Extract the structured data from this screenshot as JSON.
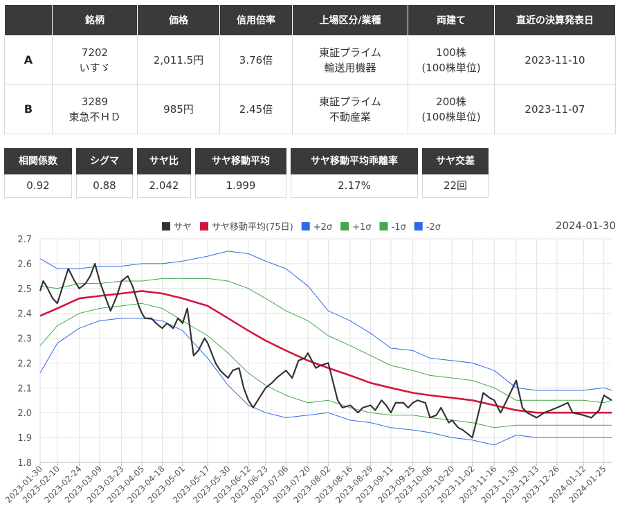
{
  "table": {
    "headers": [
      "",
      "銘柄",
      "価格",
      "信用倍率",
      "上場区分/業種",
      "両建て",
      "直近の決算発表日"
    ],
    "rows": [
      {
        "code": "A",
        "ticker": "7202",
        "name": "いすゞ",
        "price": "2,011.5円",
        "margin": "3.76倍",
        "market": "東証プライム",
        "industry": "輸送用機器",
        "hedge": "100株",
        "unit": "(100株単位)",
        "earnings": "2023-11-10"
      },
      {
        "code": "B",
        "ticker": "3289",
        "name": "東急不ＨＤ",
        "price": "985円",
        "margin": "2.45倍",
        "market": "東証プライム",
        "industry": "不動産業",
        "hedge": "200株",
        "unit": "(100株単位)",
        "earnings": "2023-11-07"
      }
    ]
  },
  "stats": [
    {
      "label": "相関係数",
      "value": "0.92"
    },
    {
      "label": "シグマ",
      "value": "0.88"
    },
    {
      "label": "サヤ比",
      "value": "2.042"
    },
    {
      "label": "サヤ移動平均",
      "value": "1.999"
    },
    {
      "label": "サヤ移動平均乖離率",
      "value": "2.17%"
    },
    {
      "label": "サヤ交差",
      "value": "22回"
    }
  ],
  "chart_data": {
    "type": "line",
    "date_label": "2024-01-30",
    "ylim": [
      1.8,
      2.7
    ],
    "y_ticks": [
      1.8,
      1.9,
      2.0,
      2.1,
      2.2,
      2.3,
      2.4,
      2.5,
      2.6,
      2.7
    ],
    "x_range": [
      "2023-01-30",
      "2024-01-30"
    ],
    "x_ticks": [
      "2023-01-30",
      "2023-02-10",
      "2023-02-24",
      "2023-03-09",
      "2023-03-23",
      "2023-04-05",
      "2023-04-18",
      "2023-05-01",
      "2023-05-17",
      "2023-05-30",
      "2023-06-12",
      "2023-06-23",
      "2023-07-06",
      "2023-07-20",
      "2023-08-02",
      "2023-08-16",
      "2023-08-29",
      "2023-09-11",
      "2023-09-25",
      "2023-10-06",
      "2023-10-20",
      "2023-11-02",
      "2023-11-16",
      "2023-11-30",
      "2023-12-13",
      "2023-12-26",
      "2024-01-12",
      "2024-01-25"
    ],
    "legend_position": "top",
    "grid": true,
    "series": [
      {
        "name": "サヤ",
        "color": "#333333",
        "x": [
          "2023-01-30",
          "2023-02-01",
          "2023-02-03",
          "2023-02-07",
          "2023-02-10",
          "2023-02-14",
          "2023-02-17",
          "2023-02-21",
          "2023-02-24",
          "2023-02-28",
          "2023-03-03",
          "2023-03-06",
          "2023-03-09",
          "2023-03-13",
          "2023-03-16",
          "2023-03-20",
          "2023-03-23",
          "2023-03-27",
          "2023-03-30",
          "2023-04-03",
          "2023-04-05",
          "2023-04-07",
          "2023-04-11",
          "2023-04-14",
          "2023-04-18",
          "2023-04-21",
          "2023-04-25",
          "2023-04-28",
          "2023-05-01",
          "2023-05-04",
          "2023-05-08",
          "2023-05-11",
          "2023-05-15",
          "2023-05-17",
          "2023-05-22",
          "2023-05-25",
          "2023-05-30",
          "2023-06-02",
          "2023-06-06",
          "2023-06-09",
          "2023-06-12",
          "2023-06-15",
          "2023-06-19",
          "2023-06-23",
          "2023-06-27",
          "2023-06-30",
          "2023-07-06",
          "2023-07-10",
          "2023-07-14",
          "2023-07-18",
          "2023-07-20",
          "2023-07-25",
          "2023-07-28",
          "2023-08-02",
          "2023-08-04",
          "2023-08-08",
          "2023-08-11",
          "2023-08-16",
          "2023-08-21",
          "2023-08-24",
          "2023-08-29",
          "2023-09-01",
          "2023-09-05",
          "2023-09-08",
          "2023-09-11",
          "2023-09-14",
          "2023-09-19",
          "2023-09-22",
          "2023-09-25",
          "2023-09-28",
          "2023-10-03",
          "2023-10-06",
          "2023-10-10",
          "2023-10-13",
          "2023-10-18",
          "2023-10-20",
          "2023-10-24",
          "2023-10-27",
          "2023-11-02",
          "2023-11-06",
          "2023-11-09",
          "2023-11-13",
          "2023-11-16",
          "2023-11-20",
          "2023-11-24",
          "2023-11-30",
          "2023-12-04",
          "2023-12-07",
          "2023-12-13",
          "2023-12-18",
          "2023-12-22",
          "2023-12-26",
          "2024-01-02",
          "2024-01-05",
          "2024-01-12",
          "2024-01-17",
          "2024-01-22",
          "2024-01-25",
          "2024-01-30"
        ],
        "values": [
          2.49,
          2.53,
          2.51,
          2.46,
          2.44,
          2.52,
          2.58,
          2.53,
          2.5,
          2.52,
          2.55,
          2.6,
          2.53,
          2.46,
          2.41,
          2.47,
          2.53,
          2.55,
          2.51,
          2.43,
          2.4,
          2.38,
          2.38,
          2.36,
          2.34,
          2.36,
          2.34,
          2.38,
          2.36,
          2.42,
          2.23,
          2.25,
          2.3,
          2.28,
          2.2,
          2.17,
          2.14,
          2.17,
          2.18,
          2.1,
          2.05,
          2.02,
          2.06,
          2.1,
          2.12,
          2.14,
          2.17,
          2.14,
          2.21,
          2.22,
          2.24,
          2.18,
          2.19,
          2.2,
          2.15,
          2.05,
          2.02,
          2.03,
          2.0,
          2.02,
          2.03,
          2.01,
          2.05,
          2.03,
          2.0,
          2.04,
          2.04,
          2.02,
          2.04,
          2.05,
          2.04,
          1.98,
          1.99,
          2.02,
          1.96,
          1.97,
          1.94,
          1.93,
          1.9,
          2.0,
          2.08,
          2.06,
          2.05,
          2.0,
          2.05,
          2.13,
          2.02,
          2.0,
          1.98,
          2.0,
          2.01,
          2.02,
          2.04,
          2.0,
          1.99,
          1.98,
          2.01,
          2.07,
          2.05
        ]
      },
      {
        "name": "サヤ移動平均(75日)",
        "color": "#d4163c",
        "x": [
          "2023-01-30",
          "2023-02-10",
          "2023-02-24",
          "2023-03-09",
          "2023-03-23",
          "2023-04-05",
          "2023-04-18",
          "2023-05-01",
          "2023-05-17",
          "2023-05-30",
          "2023-06-12",
          "2023-06-23",
          "2023-07-06",
          "2023-07-20",
          "2023-08-02",
          "2023-08-16",
          "2023-08-29",
          "2023-09-11",
          "2023-09-25",
          "2023-10-06",
          "2023-10-20",
          "2023-11-02",
          "2023-11-16",
          "2023-11-30",
          "2023-12-13",
          "2023-12-26",
          "2024-01-12",
          "2024-01-25",
          "2024-01-30"
        ],
        "values": [
          2.39,
          2.42,
          2.46,
          2.47,
          2.48,
          2.49,
          2.48,
          2.46,
          2.43,
          2.38,
          2.33,
          2.29,
          2.25,
          2.21,
          2.18,
          2.15,
          2.12,
          2.1,
          2.08,
          2.07,
          2.06,
          2.05,
          2.03,
          2.01,
          2.0,
          2.0,
          2.0,
          2.0,
          2.0
        ]
      },
      {
        "name": "+2σ",
        "color": "#2f6ae8",
        "x": [
          "2023-01-30",
          "2023-02-10",
          "2023-02-24",
          "2023-03-09",
          "2023-03-23",
          "2023-04-05",
          "2023-04-18",
          "2023-05-01",
          "2023-05-17",
          "2023-05-30",
          "2023-06-12",
          "2023-06-23",
          "2023-07-06",
          "2023-07-20",
          "2023-08-02",
          "2023-08-16",
          "2023-08-29",
          "2023-09-11",
          "2023-09-25",
          "2023-10-06",
          "2023-10-20",
          "2023-11-02",
          "2023-11-16",
          "2023-11-30",
          "2023-12-13",
          "2023-12-26",
          "2024-01-12",
          "2024-01-25",
          "2024-01-30"
        ],
        "values": [
          2.62,
          2.58,
          2.58,
          2.59,
          2.59,
          2.6,
          2.6,
          2.61,
          2.63,
          2.65,
          2.64,
          2.61,
          2.58,
          2.51,
          2.41,
          2.37,
          2.32,
          2.26,
          2.25,
          2.22,
          2.21,
          2.2,
          2.17,
          2.1,
          2.09,
          2.09,
          2.09,
          2.1,
          2.09
        ]
      },
      {
        "name": "+1σ",
        "color": "#44a84a",
        "x": [
          "2023-01-30",
          "2023-02-10",
          "2023-02-24",
          "2023-03-09",
          "2023-03-23",
          "2023-04-05",
          "2023-04-18",
          "2023-05-01",
          "2023-05-17",
          "2023-05-30",
          "2023-06-12",
          "2023-06-23",
          "2023-07-06",
          "2023-07-20",
          "2023-08-02",
          "2023-08-16",
          "2023-08-29",
          "2023-09-11",
          "2023-09-25",
          "2023-10-06",
          "2023-10-20",
          "2023-11-02",
          "2023-11-16",
          "2023-11-30",
          "2023-12-13",
          "2023-12-26",
          "2024-01-12",
          "2024-01-25",
          "2024-01-30"
        ],
        "values": [
          2.51,
          2.5,
          2.52,
          2.52,
          2.53,
          2.53,
          2.54,
          2.54,
          2.54,
          2.53,
          2.5,
          2.46,
          2.41,
          2.37,
          2.31,
          2.27,
          2.23,
          2.19,
          2.17,
          2.15,
          2.14,
          2.13,
          2.1,
          2.05,
          2.05,
          2.05,
          2.05,
          2.04,
          2.05
        ]
      },
      {
        "name": "-1σ",
        "color": "#44a84a",
        "x": [
          "2023-01-30",
          "2023-02-10",
          "2023-02-24",
          "2023-03-09",
          "2023-03-23",
          "2023-04-05",
          "2023-04-18",
          "2023-05-01",
          "2023-05-17",
          "2023-05-30",
          "2023-06-12",
          "2023-06-23",
          "2023-07-06",
          "2023-07-20",
          "2023-08-02",
          "2023-08-16",
          "2023-08-29",
          "2023-09-11",
          "2023-09-25",
          "2023-10-06",
          "2023-10-20",
          "2023-11-02",
          "2023-11-16",
          "2023-11-30",
          "2023-12-13",
          "2023-12-26",
          "2024-01-12",
          "2024-01-25",
          "2024-01-30"
        ],
        "values": [
          2.27,
          2.35,
          2.4,
          2.42,
          2.43,
          2.44,
          2.42,
          2.37,
          2.31,
          2.24,
          2.16,
          2.11,
          2.07,
          2.04,
          2.05,
          2.02,
          2.0,
          1.99,
          1.99,
          1.98,
          1.97,
          1.96,
          1.94,
          1.95,
          1.95,
          1.95,
          1.95,
          1.95,
          1.95
        ]
      },
      {
        "name": "-2σ",
        "color": "#2f6ae8",
        "x": [
          "2023-01-30",
          "2023-02-10",
          "2023-02-24",
          "2023-03-09",
          "2023-03-23",
          "2023-04-05",
          "2023-04-18",
          "2023-05-01",
          "2023-05-17",
          "2023-05-30",
          "2023-06-12",
          "2023-06-23",
          "2023-07-06",
          "2023-07-20",
          "2023-08-02",
          "2023-08-16",
          "2023-08-29",
          "2023-09-11",
          "2023-09-25",
          "2023-10-06",
          "2023-10-20",
          "2023-11-02",
          "2023-11-16",
          "2023-11-30",
          "2023-12-13",
          "2023-12-26",
          "2024-01-12",
          "2024-01-25",
          "2024-01-30"
        ],
        "values": [
          2.16,
          2.28,
          2.34,
          2.37,
          2.38,
          2.38,
          2.37,
          2.33,
          2.22,
          2.11,
          2.03,
          2.0,
          1.98,
          1.99,
          2.0,
          1.97,
          1.96,
          1.94,
          1.93,
          1.92,
          1.9,
          1.89,
          1.87,
          1.91,
          1.9,
          1.9,
          1.9,
          1.9,
          1.9
        ]
      }
    ]
  }
}
